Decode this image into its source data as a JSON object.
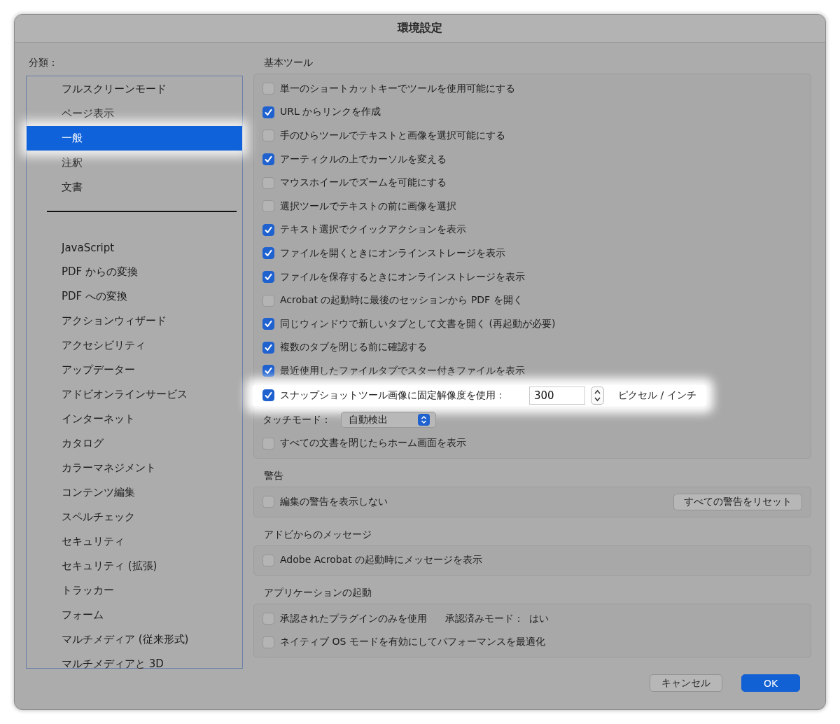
{
  "window": {
    "title": "環境設定"
  },
  "sidebar": {
    "label": "分類：",
    "groups": [
      [
        {
          "label": "フルスクリーンモード",
          "selected": false
        },
        {
          "label": "ページ表示",
          "selected": false
        },
        {
          "label": "一般",
          "selected": true
        },
        {
          "label": "注釈",
          "selected": false
        },
        {
          "label": "文書",
          "selected": false
        }
      ],
      [
        {
          "label": "JavaScript",
          "selected": false
        },
        {
          "label": "PDF からの変換",
          "selected": false
        },
        {
          "label": "PDF への変換",
          "selected": false
        },
        {
          "label": "アクションウィザード",
          "selected": false
        },
        {
          "label": "アクセシビリティ",
          "selected": false
        },
        {
          "label": "アップデーター",
          "selected": false
        },
        {
          "label": "アドビオンラインサービス",
          "selected": false
        },
        {
          "label": "インターネット",
          "selected": false
        },
        {
          "label": "カタログ",
          "selected": false
        },
        {
          "label": "カラーマネジメント",
          "selected": false
        },
        {
          "label": "コンテンツ編集",
          "selected": false
        },
        {
          "label": "スペルチェック",
          "selected": false
        },
        {
          "label": "セキュリティ",
          "selected": false
        },
        {
          "label": "セキュリティ (拡張)",
          "selected": false
        },
        {
          "label": "トラッカー",
          "selected": false
        },
        {
          "label": "フォーム",
          "selected": false
        },
        {
          "label": "マルチメディア (従来形式)",
          "selected": false
        },
        {
          "label": "マルチメディアと 3D",
          "selected": false
        }
      ]
    ]
  },
  "sections": [
    {
      "title": "基本ツール",
      "rows": [
        {
          "kind": "checkbox",
          "label": "単一のショートカットキーでツールを使用可能にする",
          "checked": false
        },
        {
          "kind": "checkbox",
          "label": "URL からリンクを作成",
          "checked": true
        },
        {
          "kind": "checkbox",
          "label": "手のひらツールでテキストと画像を選択可能にする",
          "checked": false
        },
        {
          "kind": "checkbox",
          "label": "アーティクルの上でカーソルを変える",
          "checked": true
        },
        {
          "kind": "checkbox",
          "label": "マウスホイールでズームを可能にする",
          "checked": false
        },
        {
          "kind": "checkbox",
          "label": "選択ツールでテキストの前に画像を選択",
          "checked": false
        },
        {
          "kind": "checkbox",
          "label": "テキスト選択でクイックアクションを表示",
          "checked": true
        },
        {
          "kind": "checkbox",
          "label": "ファイルを開くときにオンラインストレージを表示",
          "checked": true
        },
        {
          "kind": "checkbox",
          "label": "ファイルを保存するときにオンラインストレージを表示",
          "checked": true
        },
        {
          "kind": "checkbox",
          "label": "Acrobat の起動時に最後のセッションから PDF を開く",
          "checked": false
        },
        {
          "kind": "checkbox",
          "label": "同じウィンドウで新しいタブとして文書を開く (再起動が必要)",
          "checked": true
        },
        {
          "kind": "checkbox",
          "label": "複数のタブを閉じる前に確認する",
          "checked": true
        },
        {
          "kind": "checkbox",
          "label": "最近使用したファイルタブでスター付きファイルを表示",
          "checked": true
        },
        {
          "kind": "resolution",
          "label": "スナップショットツール画像に固定解像度を使用：",
          "checked": true,
          "value": "300",
          "unit": "ピクセル / インチ",
          "highlighted": true
        },
        {
          "kind": "select",
          "label": "タッチモード：",
          "value": "自動検出"
        },
        {
          "kind": "checkbox",
          "label": "すべての文書を閉じたらホーム画面を表示",
          "checked": false
        }
      ]
    },
    {
      "title": "警告",
      "rows": [
        {
          "kind": "checkbox",
          "label": "編集の警告を表示しない",
          "checked": false,
          "button": "すべての警告をリセット"
        }
      ]
    },
    {
      "title": "アドビからのメッセージ",
      "rows": [
        {
          "kind": "checkbox",
          "label": "Adobe Acrobat の起動時にメッセージを表示",
          "checked": false
        }
      ]
    },
    {
      "title": "アプリケーションの起動",
      "rows": [
        {
          "kind": "checkbox",
          "label": "承認されたプラグインのみを使用",
          "checked": false,
          "note_label": "承認済みモード：",
          "note_value": "はい"
        },
        {
          "kind": "checkbox",
          "label": "ネイティブ OS モードを有効にしてパフォーマンスを最適化",
          "checked": false
        }
      ]
    }
  ],
  "buttons": {
    "cancel": "キャンセル",
    "ok": "OK"
  }
}
